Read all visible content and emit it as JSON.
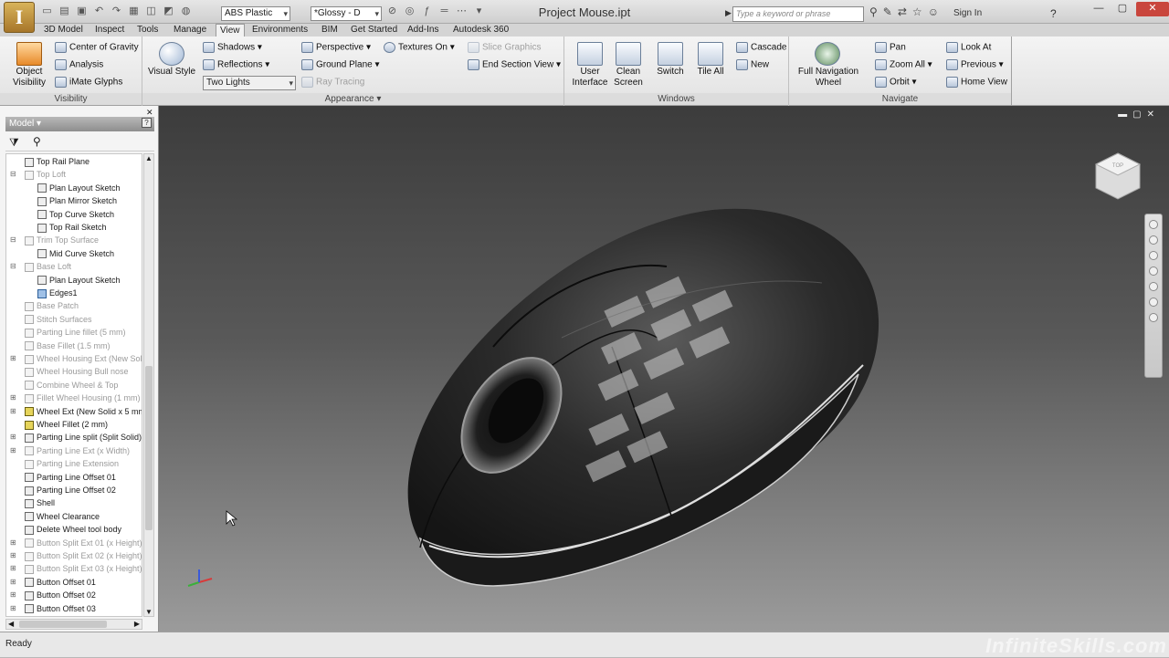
{
  "app": {
    "logo_letter": "I",
    "title": "Project Mouse.ipt"
  },
  "qat": {
    "material": "ABS Plastic",
    "appearance": "*Glossy - D"
  },
  "search": {
    "placeholder": "Type a keyword or phrase"
  },
  "signin": "Sign In",
  "tabs": [
    "3D Model",
    "Inspect",
    "Tools",
    "Manage",
    "View",
    "Environments",
    "BIM",
    "Get Started",
    "Add-Ins",
    "Autodesk 360"
  ],
  "active_tab": "View",
  "ribbon": {
    "visibility": {
      "label": "Visibility",
      "object_visibility": "Object\nVisibility",
      "center_of_gravity": "Center of Gravity",
      "analysis": "Analysis",
      "imate_glyphs": "iMate Glyphs"
    },
    "appearance": {
      "label": "Appearance",
      "visual_style": "Visual Style",
      "shadows": "Shadows",
      "reflections": "Reflections",
      "lighting": "Two Lights",
      "perspective": "Perspective",
      "ground_plane": "Ground Plane",
      "ray_tracing": "Ray Tracing",
      "textures_on": "Textures On",
      "slice_graphics": "Slice Graphics",
      "end_section_view": "End Section View"
    },
    "windows": {
      "label": "Windows",
      "user_interface": "User\nInterface",
      "clean_screen": "Clean\nScreen",
      "switch": "Switch",
      "tile_all": "Tile All",
      "cascade": "Cascade",
      "new": "New"
    },
    "navigate": {
      "label": "Navigate",
      "full_navigation_wheel": "Full Navigation\nWheel",
      "pan": "Pan",
      "zoom_all": "Zoom All",
      "orbit": "Orbit",
      "look_at": "Look At",
      "previous": "Previous",
      "home_view": "Home View"
    }
  },
  "browser": {
    "title": "Model",
    "nodes": [
      {
        "label": "Top Rail Plane",
        "style": "n"
      },
      {
        "label": "Top Loft",
        "style": "g"
      },
      {
        "label": "Plan Layout Sketch",
        "style": "n"
      },
      {
        "label": "Plan Mirror Sketch",
        "style": "n"
      },
      {
        "label": "Top Curve Sketch",
        "style": "n"
      },
      {
        "label": "Top Rail Sketch",
        "style": "n"
      },
      {
        "label": "Trim Top Surface",
        "style": "g"
      },
      {
        "label": "Mid Curve Sketch",
        "style": "n"
      },
      {
        "label": "Base Loft",
        "style": "g"
      },
      {
        "label": "Plan Layout Sketch",
        "style": "n"
      },
      {
        "label": "Edges1",
        "style": "b"
      },
      {
        "label": "Base Patch",
        "style": "g"
      },
      {
        "label": "Stitch Surfaces",
        "style": "g"
      },
      {
        "label": "Parting Line fillet (5 mm)",
        "style": "g"
      },
      {
        "label": "Base Fillet (1.5 mm)",
        "style": "g"
      },
      {
        "label": "Wheel Housing Ext (New Sol",
        "style": "g"
      },
      {
        "label": "Wheel Housing Bull nose",
        "style": "g"
      },
      {
        "label": "Combine Wheel & Top",
        "style": "g"
      },
      {
        "label": "Fillet Wheel Housing (1 mm)",
        "style": "g"
      },
      {
        "label": "Wheel Ext (New Solid x 5 mm",
        "style": "y"
      },
      {
        "label": "Wheel Fillet (2 mm)",
        "style": "y"
      },
      {
        "label": "Parting Line split (Split Solid)",
        "style": "n"
      },
      {
        "label": "Parting Line Ext (x Width)",
        "style": "g"
      },
      {
        "label": "Parting Line Extension",
        "style": "g"
      },
      {
        "label": "Parting Line Offset 01",
        "style": "n"
      },
      {
        "label": "Parting Line Offset 02",
        "style": "n"
      },
      {
        "label": "Shell",
        "style": "n"
      },
      {
        "label": "Wheel Clearance",
        "style": "n"
      },
      {
        "label": "Delete Wheel tool body",
        "style": "n"
      },
      {
        "label": "Button Split Ext 01 (x Height)",
        "style": "g"
      },
      {
        "label": "Button Split Ext 02 (x Height)",
        "style": "g"
      },
      {
        "label": "Button Split Ext 03 (x Height)",
        "style": "g"
      },
      {
        "label": "Button Offset 01",
        "style": "n"
      },
      {
        "label": "Button Offset 02",
        "style": "n"
      },
      {
        "label": "Button Offset 03",
        "style": "n"
      }
    ]
  },
  "viewcube": {
    "face": "TOP"
  },
  "status": {
    "text": "Ready"
  },
  "watermark": "InfiniteSkills.com"
}
